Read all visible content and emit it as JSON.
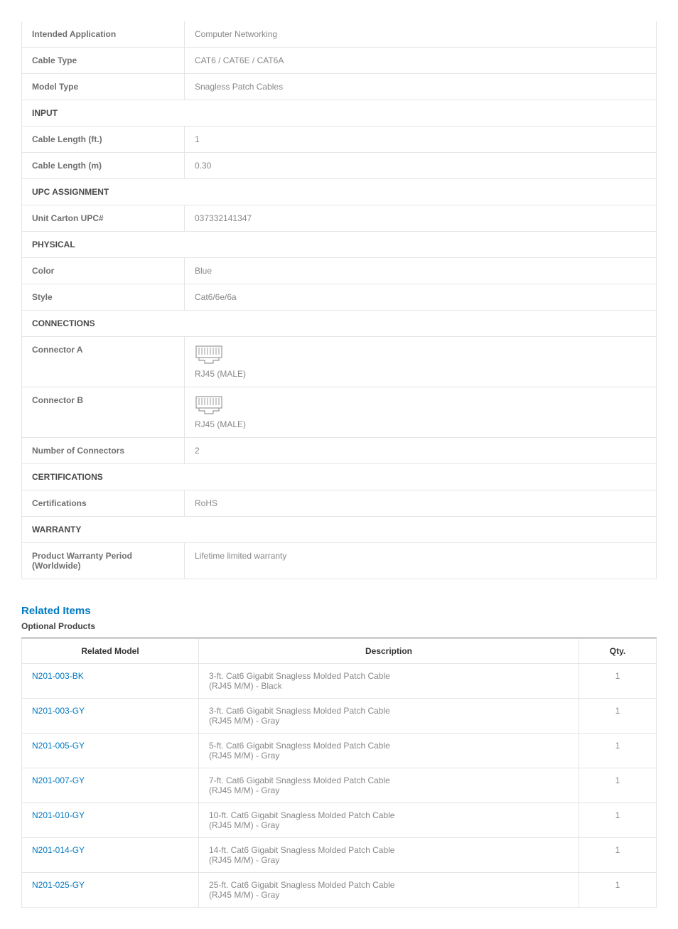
{
  "specs": {
    "intended_application": {
      "label": "Intended Application",
      "value": "Computer Networking"
    },
    "cable_type": {
      "label": "Cable Type",
      "value": "CAT6 / CAT6E / CAT6A"
    },
    "model_type": {
      "label": "Model Type",
      "value": "Snagless Patch Cables"
    },
    "section_input": "INPUT",
    "cable_length_ft": {
      "label": "Cable Length (ft.)",
      "value": "1"
    },
    "cable_length_m": {
      "label": "Cable Length (m)",
      "value": "0.30"
    },
    "section_upc": "UPC ASSIGNMENT",
    "unit_carton_upc": {
      "label": "Unit Carton UPC#",
      "value": "037332141347"
    },
    "section_physical": "PHYSICAL",
    "color": {
      "label": "Color",
      "value": "Blue"
    },
    "style": {
      "label": "Style",
      "value": "Cat6/6e/6a"
    },
    "section_connections": "CONNECTIONS",
    "connector_a": {
      "label": "Connector A",
      "value": "RJ45 (MALE)"
    },
    "connector_b": {
      "label": "Connector B",
      "value": "RJ45 (MALE)"
    },
    "num_connectors": {
      "label": "Number of Connectors",
      "value": "2"
    },
    "section_cert": "CERTIFICATIONS",
    "certifications": {
      "label": "Certifications",
      "value": "RoHS"
    },
    "section_warranty": "WARRANTY",
    "warranty_period": {
      "label": "Product Warranty Period (Worldwide)",
      "value": "Lifetime limited warranty"
    }
  },
  "related": {
    "heading": "Related Items",
    "subheading": "Optional Products",
    "columns": {
      "model": "Related Model",
      "description": "Description",
      "qty": "Qty."
    },
    "items": [
      {
        "model": "N201-003-BK",
        "description": "3-ft. Cat6 Gigabit Snagless Molded Patch Cable (RJ45 M/M) - Black",
        "qty": "1"
      },
      {
        "model": "N201-003-GY",
        "description": "3-ft. Cat6 Gigabit Snagless Molded Patch Cable (RJ45 M/M) - Gray",
        "qty": "1"
      },
      {
        "model": "N201-005-GY",
        "description": "5-ft. Cat6 Gigabit Snagless Molded Patch Cable (RJ45 M/M) - Gray",
        "qty": "1"
      },
      {
        "model": "N201-007-GY",
        "description": "7-ft. Cat6 Gigabit Snagless Molded Patch Cable (RJ45 M/M) - Gray",
        "qty": "1"
      },
      {
        "model": "N201-010-GY",
        "description": "10-ft. Cat6 Gigabit Snagless Molded Patch Cable (RJ45 M/M) - Gray",
        "qty": "1"
      },
      {
        "model": "N201-014-GY",
        "description": "14-ft. Cat6 Gigabit Snagless Molded Patch Cable (RJ45 M/M) - Gray",
        "qty": "1"
      },
      {
        "model": "N201-025-GY",
        "description": "25-ft. Cat6 Gigabit Snagless Molded Patch Cable (RJ45 M/M) - Gray",
        "qty": "1"
      }
    ]
  }
}
